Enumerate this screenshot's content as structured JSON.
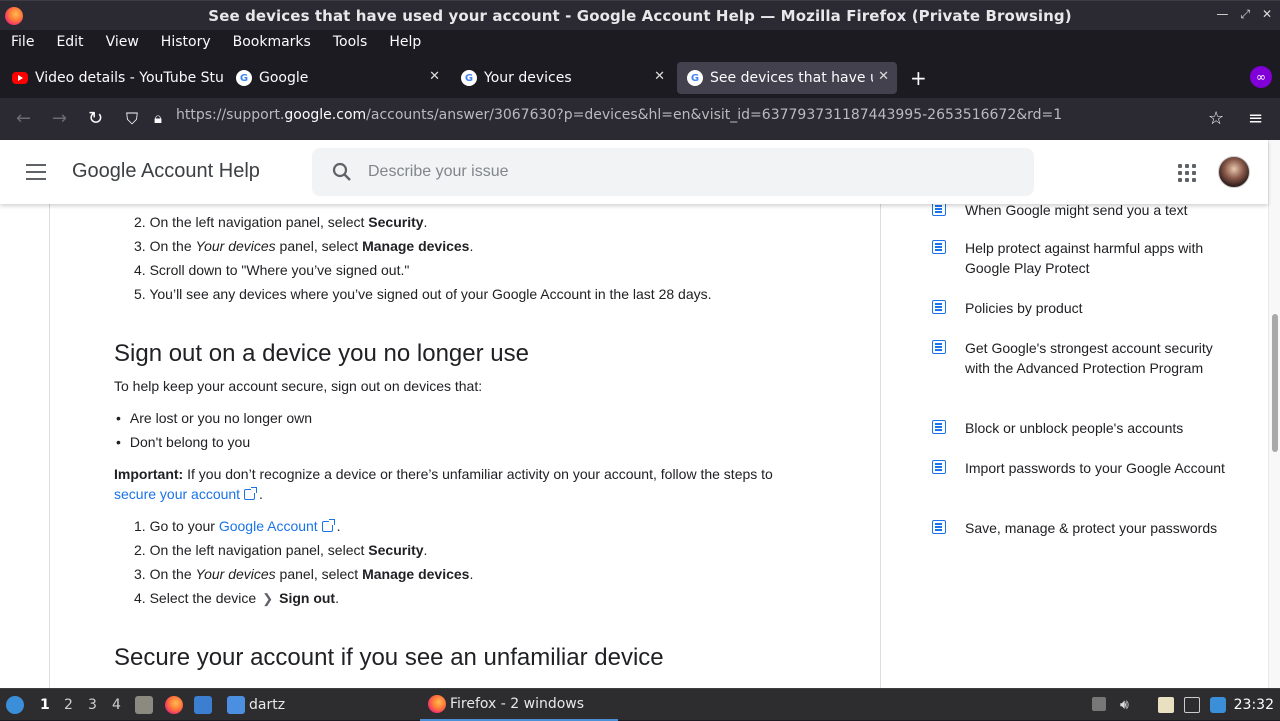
{
  "window": {
    "title": "See devices that have used your account - Google Account Help — Mozilla Firefox (Private Browsing)"
  },
  "menu": [
    "File",
    "Edit",
    "View",
    "History",
    "Bookmarks",
    "Tools",
    "Help"
  ],
  "tabs": [
    {
      "label": "Video details - YouTube Studio",
      "favicon": "youtube-icon",
      "active": false
    },
    {
      "label": "Google",
      "favicon": "google-icon",
      "active": false
    },
    {
      "label": "Your devices",
      "favicon": "google-icon",
      "active": false
    },
    {
      "label": "See devices that have used your account",
      "favicon": "google-icon",
      "active": true
    }
  ],
  "url": {
    "prefix": "https://support.",
    "domain": "google.com",
    "path": "/accounts/answer/3067630?p=devices&hl=en&visit_id=637793731187443995-2653516672&rd=1"
  },
  "header": {
    "brand": "Google Account Help",
    "search_placeholder": "Describe your issue"
  },
  "article": {
    "steps_top": [
      {
        "num": "2.",
        "pre": "On the left navigation panel, select ",
        "bold": "Security",
        "post": "."
      },
      {
        "num": "3.",
        "pre": "On the ",
        "ital": "Your devices",
        "mid": " panel, select ",
        "bold": "Manage devices",
        "post": "."
      },
      {
        "num": "4.",
        "text": "Scroll down to \"Where you’ve signed out.\""
      },
      {
        "num": "5.",
        "text": "You’ll see any devices where you’ve signed out of your Google Account in the last 28 days."
      }
    ],
    "heading_signout": "Sign out on a device you no longer use",
    "intro": "To help keep your account secure, sign out on devices that:",
    "bullets": [
      "Are lost or you no longer own",
      "Don't belong to you"
    ],
    "important_label": "Important:",
    "important_text": " If you don’t recognize a device or there’s unfamiliar activity on your account, follow the steps to",
    "secure_link": "secure your account",
    "steps_signout": {
      "s1_num": "1.",
      "s1_pre": "Go to your ",
      "s1_link": "Google Account",
      "s2_num": "2.",
      "s2_pre": "On the left navigation panel, select ",
      "s2_bold": "Security",
      "s3_num": "3.",
      "s3_pre": "On the ",
      "s3_ital": "Your devices",
      "s3_mid": " panel, select ",
      "s3_bold": "Manage devices",
      "s4_num": "4.",
      "s4_pre": "Select the device",
      "s4_bold": "Sign out"
    },
    "heading_secure": "Secure your account if you see an unfamiliar device"
  },
  "sidebar": [
    "When Google might send you a text",
    "Help protect against harmful apps with Google Play Protect",
    "Policies by product",
    "Get Google's strongest account security with the Advanced Protection Program",
    "Block or unblock people's accounts",
    "Import passwords to your Google Account",
    "Save, manage & protect your passwords"
  ],
  "taskbar": {
    "workspaces": [
      "1",
      "2",
      "3",
      "4"
    ],
    "folder_label": "dartz",
    "app_label": "Firefox - 2 windows",
    "clock": "23:32"
  }
}
